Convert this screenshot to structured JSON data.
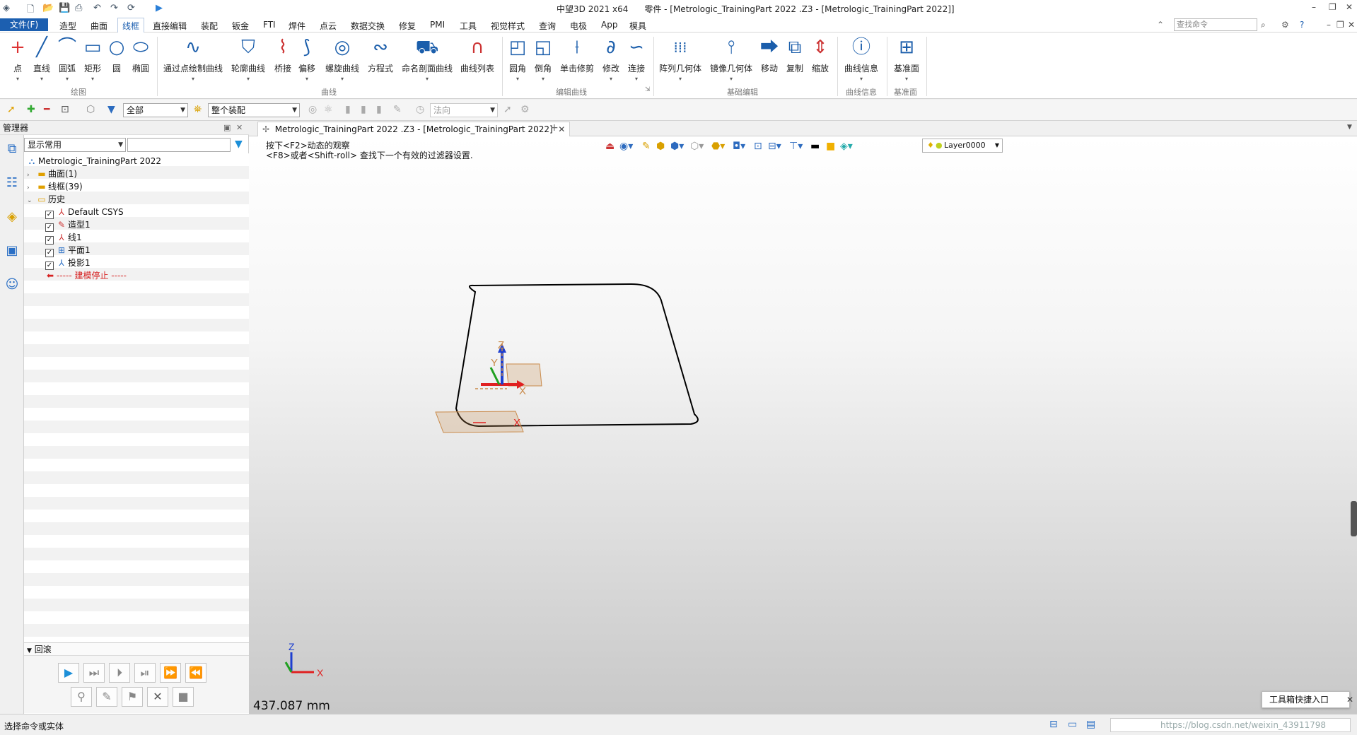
{
  "app": {
    "title_center": "中望3D 2021 x64",
    "title_doc": "零件 - [Metrologic_TrainingPart  2022 .Z3 - [Metrologic_TrainingPart  2022]]",
    "window_buttons": [
      "–",
      "❐",
      "✕"
    ]
  },
  "menu": {
    "file": "文件(F)",
    "tabs": [
      "造型",
      "曲面",
      "线框",
      "直接编辑",
      "装配",
      "钣金",
      "FTI",
      "焊件",
      "点云",
      "数据交换",
      "修复",
      "PMI",
      "工具",
      "视觉样式",
      "查询",
      "电极",
      "App",
      "模具"
    ],
    "active_tab": "线框",
    "search_placeholder": "查找命令"
  },
  "ribbon": {
    "buttons": {
      "point": "点",
      "line": "直线",
      "arc": "圆弧",
      "rect": "矩形",
      "circle": "圆",
      "ellipse": "椭圆",
      "through_point": "通过点绘制曲线",
      "contour": "轮廓曲线",
      "bridge": "桥接",
      "offset": "偏移",
      "helix": "螺旋曲线",
      "equation": "方程式",
      "named_section": "命名剖面曲线",
      "curve_list": "曲线列表",
      "fillet": "圆角",
      "chamfer": "倒角",
      "trim": "单击修剪",
      "modify": "修改",
      "connect": "连接",
      "array": "阵列几何体",
      "mirror": "镜像几何体",
      "move": "移动",
      "copy": "复制",
      "scale": "缩放",
      "curve_info": "曲线信息",
      "datum": "基准面"
    },
    "groups": {
      "draw": "绘图",
      "curve": "曲线",
      "edit_curve": "编辑曲线",
      "basic_edit": "基础编辑",
      "curve_info": "曲线信息",
      "datum": "基准面"
    }
  },
  "toolbar2": {
    "filter": "全部",
    "assembly": "整个装配",
    "direction": "法向"
  },
  "manager": {
    "title": "管理器",
    "display": "显示常用",
    "tree": {
      "root": "Metrologic_TrainingPart  2022",
      "surface": "曲面(1)",
      "wireframe": "线框(39)",
      "history": "历史",
      "items": [
        "Default CSYS",
        "造型1",
        "线1",
        "平面1",
        "投影1"
      ],
      "stop": "----- 建模停止 -----"
    },
    "rollback": "回滚"
  },
  "document": {
    "tab": "Metrologic_TrainingPart  2022 .Z3 - [Metrologic_TrainingPart  2022]",
    "hint1": "按下<F2>动态的观察",
    "hint2": "<F8>或者<Shift-roll> 查找下一个有效的过滤器设置.",
    "layer": "Layer0000",
    "measure": "437.087 mm",
    "axis_x": "X",
    "axis_y": "Y",
    "axis_z": "Z"
  },
  "toolbox": "工具箱快捷入口",
  "status": {
    "text": "选择命令或实体",
    "watermark": "https://blog.csdn.net/weixin_43911798"
  },
  "colors": {
    "accent": "#1c5fb0",
    "axis_x": "#e02020",
    "axis_y": "#20a020",
    "axis_z": "#1e3fd0",
    "datum_plane": "#c98a4a"
  }
}
